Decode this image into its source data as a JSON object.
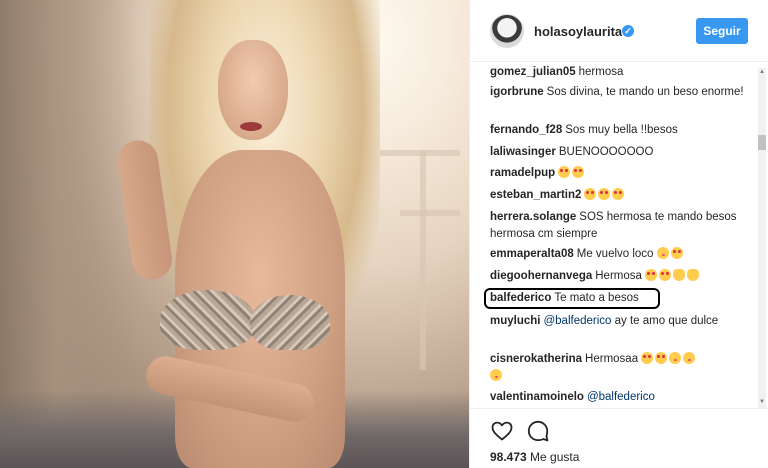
{
  "post": {
    "username": "holasoylaurita",
    "follow_label": "Seguir",
    "likes_count": "98.473",
    "likes_label": "Me gusta"
  },
  "comments": [
    {
      "user": "gomez_julian05",
      "text": "hermosa"
    },
    {
      "user": "igorbrune",
      "text": "Sos divina, te mando un beso enorme!"
    },
    {
      "user": "fernando_f28",
      "text": "Sos muy bella !!besos"
    },
    {
      "user": "laliwasinger",
      "text": "BUENOOOOOOO"
    },
    {
      "user": "ramadelpup",
      "text": ""
    },
    {
      "user": "esteban_martin2",
      "text": ""
    },
    {
      "user": "herrera.solange",
      "text": "SOS hermosa te mando besos hermosa cm siempre"
    },
    {
      "user": "emmaperalta08",
      "text": "Me vuelvo loco"
    },
    {
      "user": "diegoohernanvega",
      "text": "Hermosa"
    },
    {
      "user": "balfederico",
      "text": "Te mato a besos"
    },
    {
      "user": "muyluchi",
      "mention": "@balfederico",
      "text": "ay te amo que dulce"
    },
    {
      "user": "cisnerokatherina",
      "text": "Hermosaa"
    },
    {
      "user": "valentinamoinelo",
      "mention": "@balfederico",
      "text": ""
    }
  ],
  "colors": {
    "accent": "#3897f0",
    "text": "#262626",
    "mention": "#003569"
  },
  "icons": [
    "heart-icon",
    "comment-icon",
    "verified-badge-icon"
  ]
}
